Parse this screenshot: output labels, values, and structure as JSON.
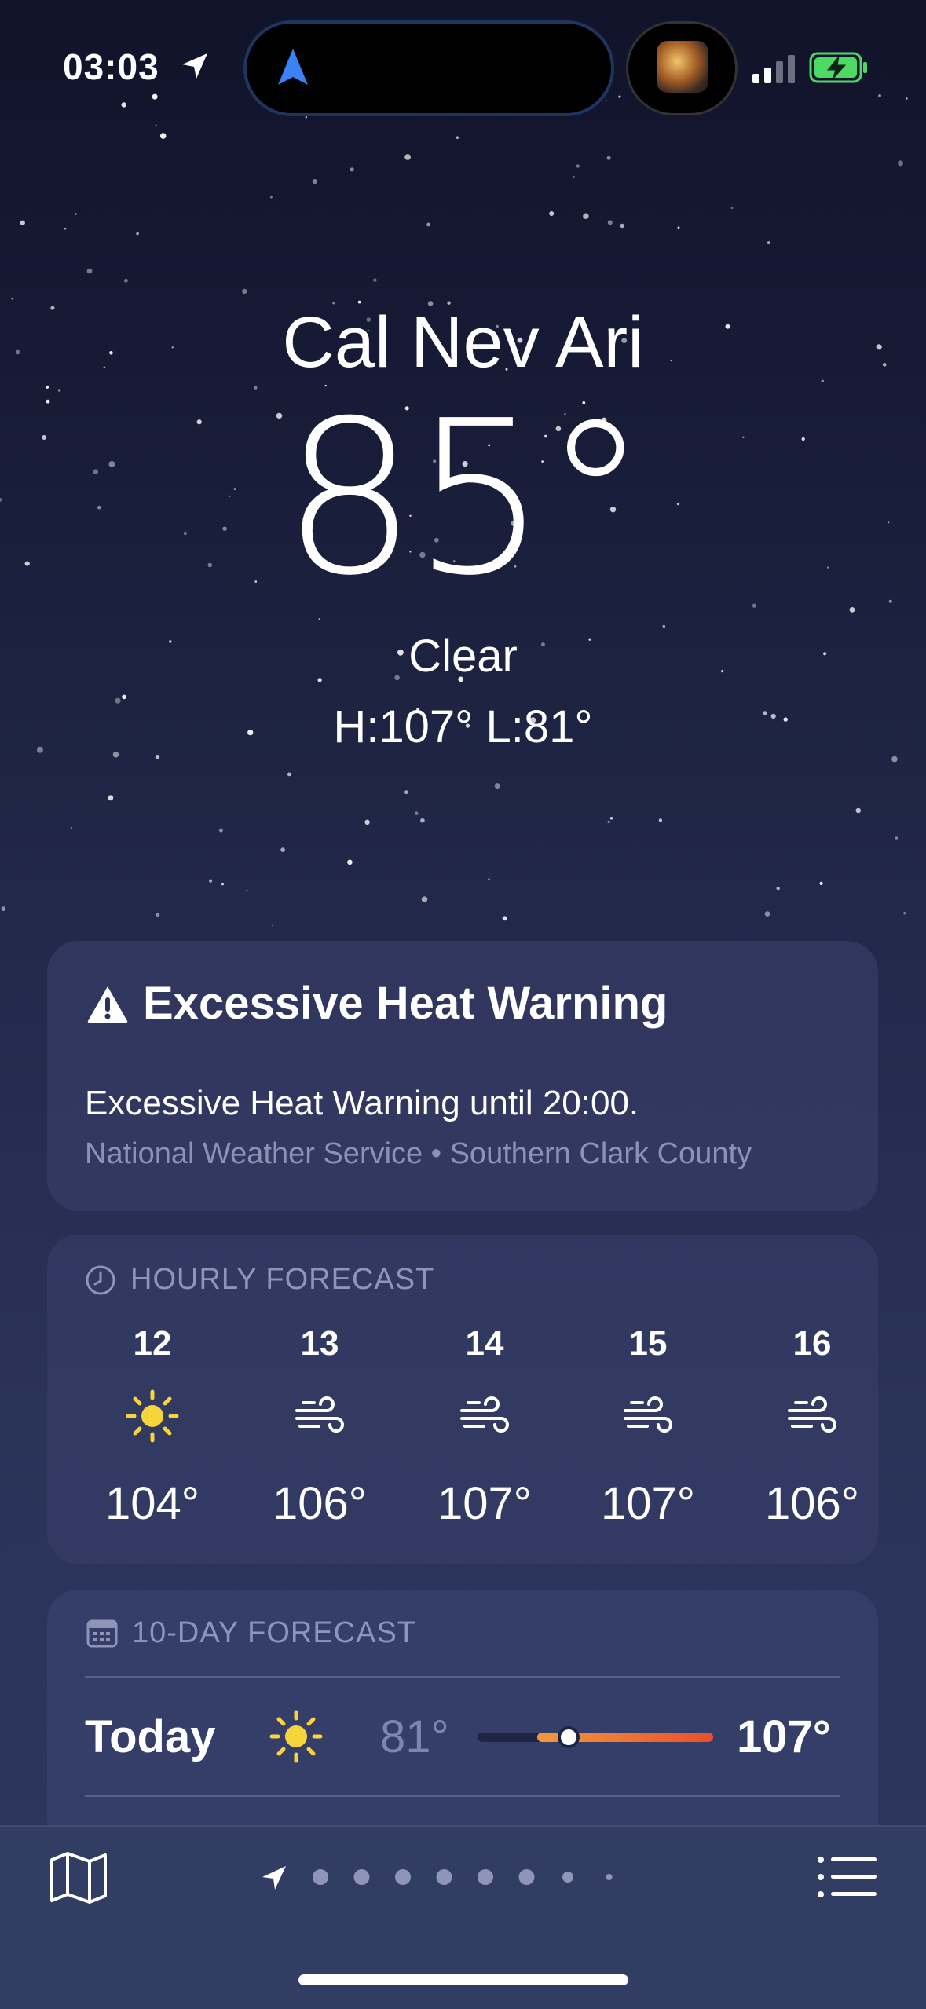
{
  "status_bar": {
    "time": "03:03",
    "icons": [
      "location-arrow-icon",
      "navigation-arrow-icon",
      "album-art",
      "signal-icon",
      "battery-charging-icon"
    ]
  },
  "location": {
    "city": "Cal Nev Ari",
    "temperature": "85°",
    "condition": "Clear",
    "high_low": "H:107°  L:81°"
  },
  "alert": {
    "title": "Excessive Heat Warning",
    "body": "Excessive Heat Warning until 20:00.",
    "source": "National Weather Service • Southern Clark County",
    "icon": "warning-triangle-icon"
  },
  "hourly": {
    "header": "HOURLY FORECAST",
    "items": [
      {
        "hour": "12",
        "icon": "sun-icon",
        "temp": "104°"
      },
      {
        "hour": "13",
        "icon": "wind-icon",
        "temp": "106°"
      },
      {
        "hour": "14",
        "icon": "wind-icon",
        "temp": "107°"
      },
      {
        "hour": "15",
        "icon": "wind-icon",
        "temp": "107°"
      },
      {
        "hour": "16",
        "icon": "wind-icon",
        "temp": "106°"
      }
    ]
  },
  "daily": {
    "header": "10-DAY FORECAST",
    "items": [
      {
        "day": "Today",
        "icon": "sun-icon",
        "low": "81°",
        "high": "107°"
      }
    ]
  },
  "colors": {
    "sun": "#f7d43a",
    "range_start": "#f29a3c",
    "range_end": "#ea4f2c",
    "battery": "#4cd964",
    "accent_blue": "#3b82f6"
  },
  "page_indicator": {
    "pages": 9,
    "current": 0
  }
}
